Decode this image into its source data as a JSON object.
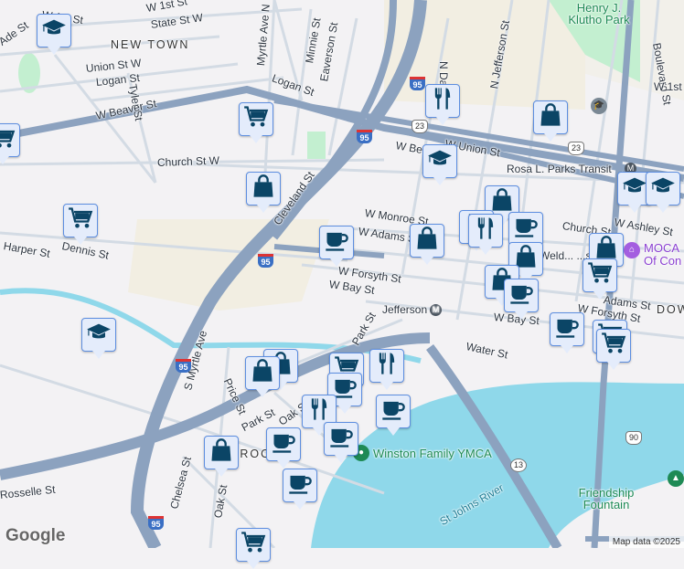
{
  "colors": {
    "water": "#8fd8ea",
    "highway": "#8ca2bf",
    "pin_bg": "#e4ecfb",
    "pin_border": "#5d8ee0",
    "icon": "#0b4566",
    "park": "#c3efd0",
    "land": "#f3f2f4",
    "sand": "#f2eee2"
  },
  "streets": [
    "W 1st St",
    "State St W",
    "W 1st St",
    "NEW TOWN",
    "Union St W",
    "Logan St",
    "Tyler St",
    "Myrtle Ave N",
    "Minnie St",
    "Eaverson St",
    "Logan St",
    "W Beaver St",
    "Church St W",
    "Cleveland St",
    "Dennis St",
    "Harper St",
    "N Davis St",
    "N Jefferson St",
    "Boulevard St",
    "W 1st St",
    "W Union St",
    "W Beaver St",
    "Rosa L. Parks Transit",
    "W Monroe St",
    "W Adams St",
    "W Forsyth St",
    "W Bay St",
    "Church St",
    "W Ashley St",
    "Adams St",
    "W Forsyth St",
    "W Bay St",
    "Water St",
    "Park St",
    "S Myrtle Ave",
    "Price St",
    "Park St",
    "Oak St",
    "Chelsea St",
    "Oak St",
    "Rosselle St",
    "DOW",
    "Ade St",
    "Jefferson",
    "BROOK"
  ],
  "places": {
    "park1": "Henry J. Klutho Park",
    "ymca": "Winston Family YMCA",
    "river": "St Johns River",
    "fountain": "Friendship Fountain",
    "moca": "MOCA Of Con",
    "welden": "Weld... ...son Pa"
  },
  "shields": {
    "i95": "95",
    "us23": "23",
    "us90": "90",
    "sr13": "13"
  },
  "transit_icon": "M",
  "markers": [
    {
      "type": "school",
      "icon": "graduation-cap-icon"
    },
    {
      "type": "grocery",
      "icon": "shopping-cart-icon"
    },
    {
      "type": "grocery",
      "icon": "shopping-cart-icon"
    },
    {
      "type": "shop",
      "icon": "shopping-bag-icon"
    },
    {
      "type": "grocery",
      "icon": "shopping-cart-icon"
    },
    {
      "type": "cafe",
      "icon": "coffee-cup-icon"
    },
    {
      "type": "restaurant",
      "icon": "fork-knife-icon"
    },
    {
      "type": "shop",
      "icon": "shopping-bag-icon"
    },
    {
      "type": "school",
      "icon": "graduation-cap-icon"
    },
    {
      "type": "shop",
      "icon": "shopping-bag-icon"
    },
    {
      "type": "restaurant",
      "icon": "fork-knife-icon"
    },
    {
      "type": "restaurant",
      "icon": "fork-knife-icon"
    },
    {
      "type": "cafe",
      "icon": "coffee-cup-icon"
    },
    {
      "type": "shop",
      "icon": "shopping-bag-icon"
    },
    {
      "type": "school",
      "icon": "graduation-cap-icon"
    },
    {
      "type": "school",
      "icon": "graduation-cap-icon"
    },
    {
      "type": "shop",
      "icon": "shopping-bag-icon"
    },
    {
      "type": "grocery",
      "icon": "shopping-cart-icon"
    },
    {
      "type": "shop",
      "icon": "shopping-bag-icon"
    },
    {
      "type": "shop",
      "icon": "shopping-bag-icon"
    },
    {
      "type": "cafe",
      "icon": "coffee-cup-icon"
    },
    {
      "type": "cafe",
      "icon": "coffee-cup-icon"
    },
    {
      "type": "grocery",
      "icon": "shopping-cart-icon"
    },
    {
      "type": "grocery",
      "icon": "shopping-cart-icon"
    },
    {
      "type": "school",
      "icon": "graduation-cap-icon"
    },
    {
      "type": "shop",
      "icon": "shopping-bag-icon"
    },
    {
      "type": "shop",
      "icon": "shopping-bag-icon"
    },
    {
      "type": "grocery",
      "icon": "shopping-cart-icon"
    },
    {
      "type": "restaurant",
      "icon": "fork-knife-icon"
    },
    {
      "type": "cafe",
      "icon": "coffee-cup-icon"
    },
    {
      "type": "restaurant",
      "icon": "fork-knife-icon"
    },
    {
      "type": "cafe",
      "icon": "coffee-cup-icon"
    },
    {
      "type": "cafe",
      "icon": "coffee-cup-icon"
    },
    {
      "type": "cafe",
      "icon": "coffee-cup-icon"
    },
    {
      "type": "shop",
      "icon": "shopping-bag-icon"
    },
    {
      "type": "cafe",
      "icon": "coffee-cup-icon"
    },
    {
      "type": "grocery",
      "icon": "shopping-cart-icon"
    }
  ],
  "footer": {
    "logo": "Google",
    "attribution": "Map data ©2025"
  }
}
